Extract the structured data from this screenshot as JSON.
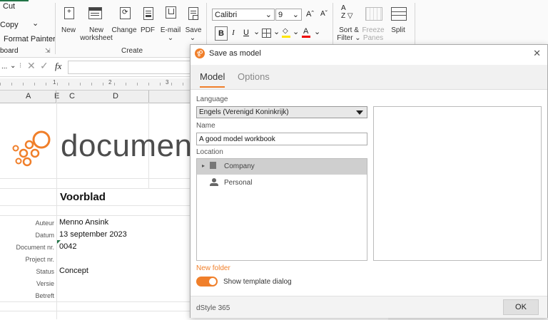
{
  "ribbon": {
    "clipboard": {
      "cut": "Cut",
      "copy": "Copy",
      "copy_caret": "⌄",
      "format_painter": "Format Painter",
      "group_label": "board"
    },
    "create": {
      "new": "New",
      "new_worksheet_line1": "New",
      "new_worksheet_line2": "worksheet",
      "change": "Change",
      "pdf": "PDF",
      "email": "E-mail",
      "save": "Save",
      "save_caret": "⌄",
      "group_label": "Create"
    },
    "font": {
      "name": "Calibri",
      "size": "9",
      "grow": "Aˆ",
      "shrink": "Aˇ",
      "bold": "B",
      "italic": "I",
      "underline": "U"
    },
    "sort_filter_line1": "Sort &",
    "sort_filter_line2": "Filter ⌄",
    "freeze_line1": "Freeze",
    "freeze_line2": "Panes ⌄",
    "split": "Split"
  },
  "formula_bar": {
    "namebox": "...",
    "fx": "fx"
  },
  "sheet": {
    "columns": [
      "A",
      "E",
      "C",
      "D"
    ],
    "logo_text": "documenta",
    "heading": "Voorblad",
    "rows": [
      {
        "label": "Auteur",
        "value": "Menno Ansink"
      },
      {
        "label": "Datum",
        "value": "13 september 2023"
      },
      {
        "label": "Document nr.",
        "value": "0042"
      },
      {
        "label": "Project nr.",
        "value": ""
      },
      {
        "label": "Status",
        "value": "Concept"
      },
      {
        "label": "Versie",
        "value": ""
      },
      {
        "label": "Betreft",
        "value": ""
      }
    ]
  },
  "dialog": {
    "title": "Save as model",
    "tabs": [
      "Model",
      "Options"
    ],
    "language_label": "Language",
    "language_value": "Engels (Verenigd Koninkrijk)",
    "name_label": "Name",
    "name_value": "A good model workbook",
    "location_label": "Location",
    "locations": [
      "Company",
      "Personal"
    ],
    "new_folder": "New folder",
    "toggle_label": "Show template dialog",
    "toggle_on": true,
    "brand": "dStyle 365",
    "ok": "OK",
    "accent": "#f07f2a"
  }
}
